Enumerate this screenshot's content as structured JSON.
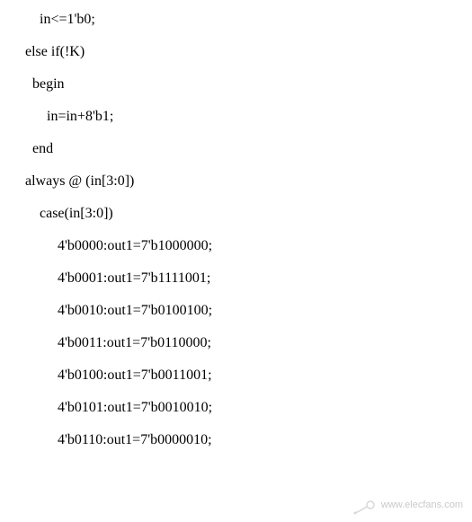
{
  "code": {
    "lines": [
      "     in<=1'b0;",
      " else if(!K)",
      "   begin",
      "       in=in+8'b1;",
      "   end",
      " always @ (in[3:0])",
      "     case(in[3:0])",
      "          4'b0000:out1=7'b1000000;",
      "          4'b0001:out1=7'b1111001;",
      "          4'b0010:out1=7'b0100100;",
      "          4'b0011:out1=7'b0110000;",
      "          4'b0100:out1=7'b0011001;",
      "          4'b0101:out1=7'b0010010;",
      "          4'b0110:out1=7'b0000010;"
    ]
  },
  "watermark": {
    "text": "www.elecfans.com"
  }
}
